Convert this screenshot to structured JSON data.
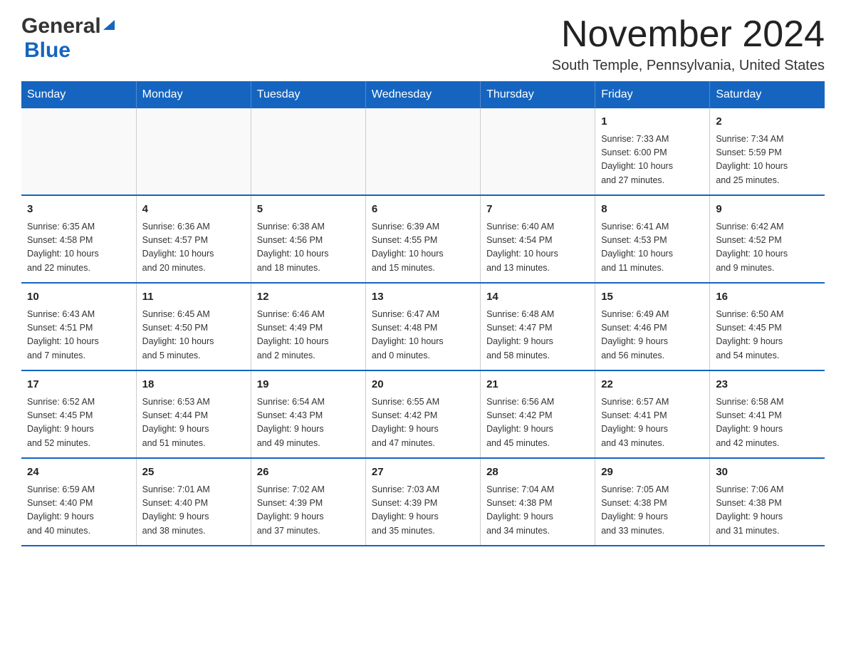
{
  "header": {
    "logo_general": "General",
    "logo_blue": "Blue",
    "title": "November 2024",
    "subtitle": "South Temple, Pennsylvania, United States"
  },
  "days_of_week": [
    "Sunday",
    "Monday",
    "Tuesday",
    "Wednesday",
    "Thursday",
    "Friday",
    "Saturday"
  ],
  "weeks": [
    [
      {
        "day": "",
        "info": ""
      },
      {
        "day": "",
        "info": ""
      },
      {
        "day": "",
        "info": ""
      },
      {
        "day": "",
        "info": ""
      },
      {
        "day": "",
        "info": ""
      },
      {
        "day": "1",
        "info": "Sunrise: 7:33 AM\nSunset: 6:00 PM\nDaylight: 10 hours\nand 27 minutes."
      },
      {
        "day": "2",
        "info": "Sunrise: 7:34 AM\nSunset: 5:59 PM\nDaylight: 10 hours\nand 25 minutes."
      }
    ],
    [
      {
        "day": "3",
        "info": "Sunrise: 6:35 AM\nSunset: 4:58 PM\nDaylight: 10 hours\nand 22 minutes."
      },
      {
        "day": "4",
        "info": "Sunrise: 6:36 AM\nSunset: 4:57 PM\nDaylight: 10 hours\nand 20 minutes."
      },
      {
        "day": "5",
        "info": "Sunrise: 6:38 AM\nSunset: 4:56 PM\nDaylight: 10 hours\nand 18 minutes."
      },
      {
        "day": "6",
        "info": "Sunrise: 6:39 AM\nSunset: 4:55 PM\nDaylight: 10 hours\nand 15 minutes."
      },
      {
        "day": "7",
        "info": "Sunrise: 6:40 AM\nSunset: 4:54 PM\nDaylight: 10 hours\nand 13 minutes."
      },
      {
        "day": "8",
        "info": "Sunrise: 6:41 AM\nSunset: 4:53 PM\nDaylight: 10 hours\nand 11 minutes."
      },
      {
        "day": "9",
        "info": "Sunrise: 6:42 AM\nSunset: 4:52 PM\nDaylight: 10 hours\nand 9 minutes."
      }
    ],
    [
      {
        "day": "10",
        "info": "Sunrise: 6:43 AM\nSunset: 4:51 PM\nDaylight: 10 hours\nand 7 minutes."
      },
      {
        "day": "11",
        "info": "Sunrise: 6:45 AM\nSunset: 4:50 PM\nDaylight: 10 hours\nand 5 minutes."
      },
      {
        "day": "12",
        "info": "Sunrise: 6:46 AM\nSunset: 4:49 PM\nDaylight: 10 hours\nand 2 minutes."
      },
      {
        "day": "13",
        "info": "Sunrise: 6:47 AM\nSunset: 4:48 PM\nDaylight: 10 hours\nand 0 minutes."
      },
      {
        "day": "14",
        "info": "Sunrise: 6:48 AM\nSunset: 4:47 PM\nDaylight: 9 hours\nand 58 minutes."
      },
      {
        "day": "15",
        "info": "Sunrise: 6:49 AM\nSunset: 4:46 PM\nDaylight: 9 hours\nand 56 minutes."
      },
      {
        "day": "16",
        "info": "Sunrise: 6:50 AM\nSunset: 4:45 PM\nDaylight: 9 hours\nand 54 minutes."
      }
    ],
    [
      {
        "day": "17",
        "info": "Sunrise: 6:52 AM\nSunset: 4:45 PM\nDaylight: 9 hours\nand 52 minutes."
      },
      {
        "day": "18",
        "info": "Sunrise: 6:53 AM\nSunset: 4:44 PM\nDaylight: 9 hours\nand 51 minutes."
      },
      {
        "day": "19",
        "info": "Sunrise: 6:54 AM\nSunset: 4:43 PM\nDaylight: 9 hours\nand 49 minutes."
      },
      {
        "day": "20",
        "info": "Sunrise: 6:55 AM\nSunset: 4:42 PM\nDaylight: 9 hours\nand 47 minutes."
      },
      {
        "day": "21",
        "info": "Sunrise: 6:56 AM\nSunset: 4:42 PM\nDaylight: 9 hours\nand 45 minutes."
      },
      {
        "day": "22",
        "info": "Sunrise: 6:57 AM\nSunset: 4:41 PM\nDaylight: 9 hours\nand 43 minutes."
      },
      {
        "day": "23",
        "info": "Sunrise: 6:58 AM\nSunset: 4:41 PM\nDaylight: 9 hours\nand 42 minutes."
      }
    ],
    [
      {
        "day": "24",
        "info": "Sunrise: 6:59 AM\nSunset: 4:40 PM\nDaylight: 9 hours\nand 40 minutes."
      },
      {
        "day": "25",
        "info": "Sunrise: 7:01 AM\nSunset: 4:40 PM\nDaylight: 9 hours\nand 38 minutes."
      },
      {
        "day": "26",
        "info": "Sunrise: 7:02 AM\nSunset: 4:39 PM\nDaylight: 9 hours\nand 37 minutes."
      },
      {
        "day": "27",
        "info": "Sunrise: 7:03 AM\nSunset: 4:39 PM\nDaylight: 9 hours\nand 35 minutes."
      },
      {
        "day": "28",
        "info": "Sunrise: 7:04 AM\nSunset: 4:38 PM\nDaylight: 9 hours\nand 34 minutes."
      },
      {
        "day": "29",
        "info": "Sunrise: 7:05 AM\nSunset: 4:38 PM\nDaylight: 9 hours\nand 33 minutes."
      },
      {
        "day": "30",
        "info": "Sunrise: 7:06 AM\nSunset: 4:38 PM\nDaylight: 9 hours\nand 31 minutes."
      }
    ]
  ],
  "colors": {
    "header_bg": "#1565c0",
    "header_text": "#ffffff",
    "border": "#1565c0",
    "text_dark": "#222222",
    "text_body": "#333333"
  }
}
